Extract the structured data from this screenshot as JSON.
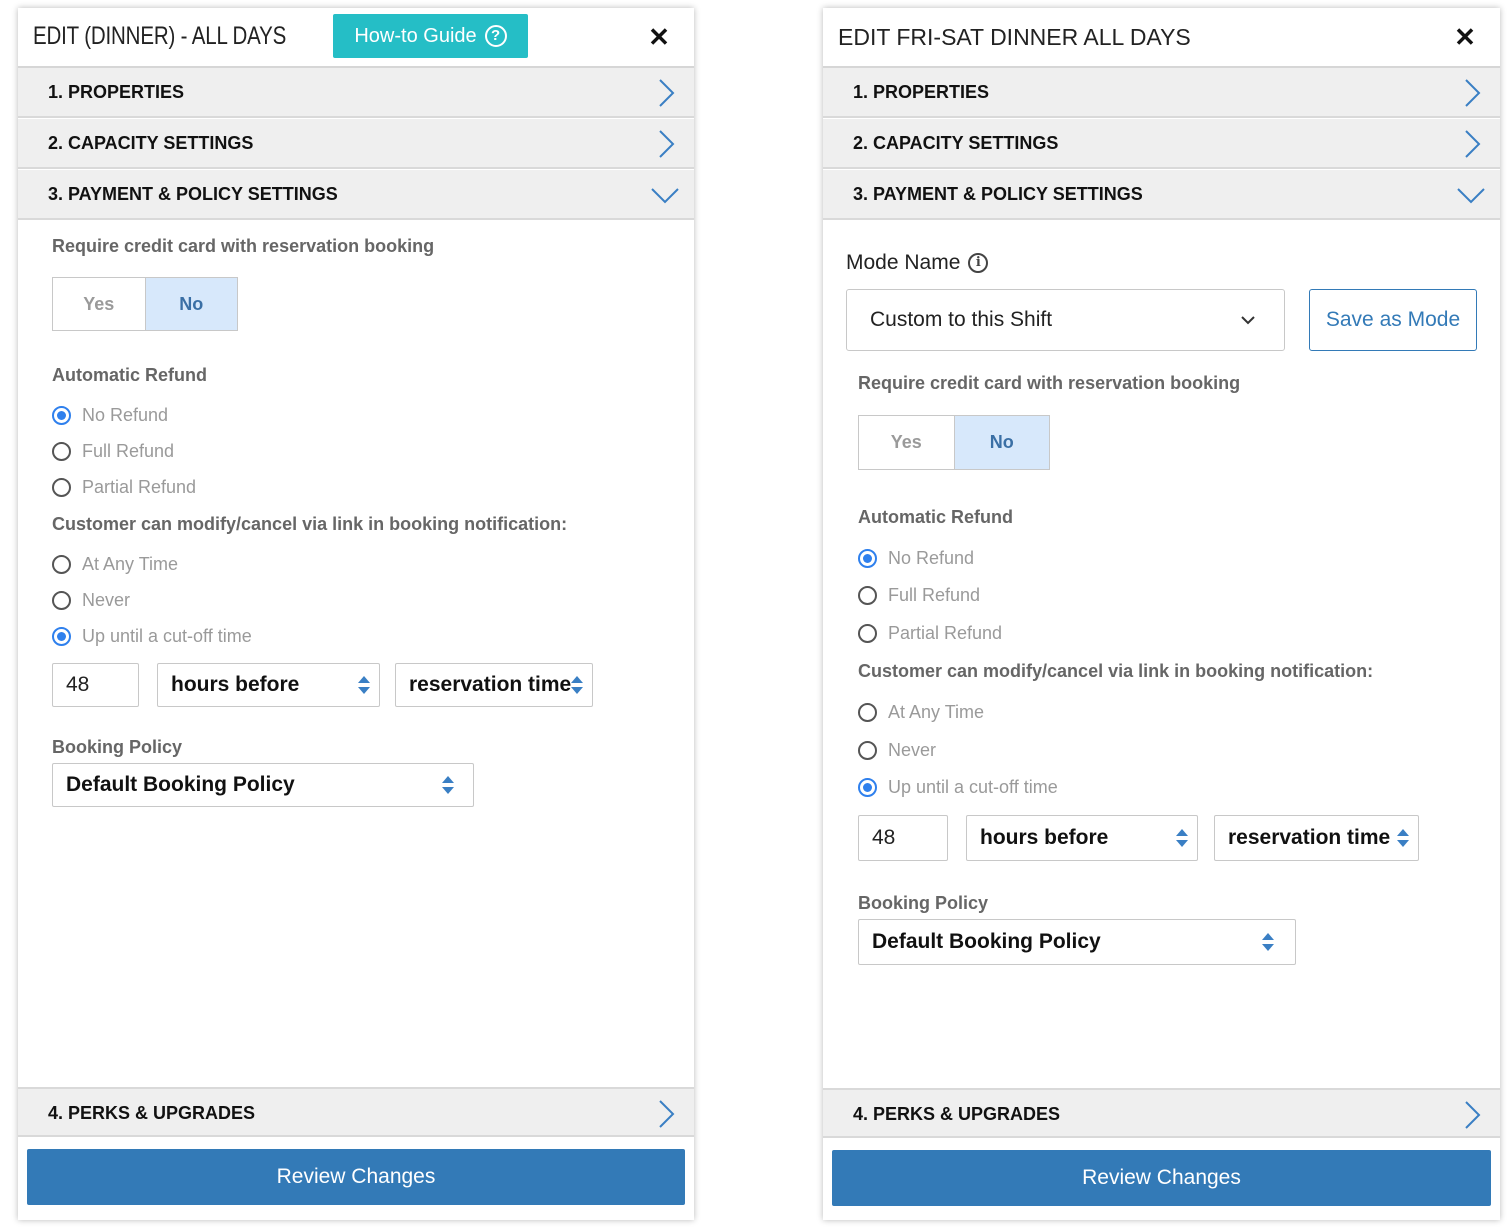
{
  "colors": {
    "accent": "#337ab7",
    "guide": "#25bec6",
    "radio_on": "#2f80ed",
    "selected_bg": "#d7e8fb"
  },
  "left": {
    "title": "EDIT (DINNER) - ALL DAYS",
    "guide_label": "How-to Guide",
    "close": "✕",
    "sections": [
      "1. PROPERTIES",
      "2. CAPACITY SETTINGS",
      "3. PAYMENT & POLICY SETTINGS",
      "4. PERKS & UPGRADES"
    ],
    "require_cc_label": "Require credit card with reservation booking",
    "yes": "Yes",
    "no": "No",
    "refund_label": "Automatic Refund",
    "refund_options": [
      "No Refund",
      "Full Refund",
      "Partial Refund"
    ],
    "refund_selected": "No Refund",
    "modify_label": "Customer can modify/cancel via link in booking notification:",
    "modify_options": [
      "At Any Time",
      "Never",
      "Up until a cut-off time"
    ],
    "modify_selected": "Up until a cut-off time",
    "cutoff_value": "48",
    "cutoff_unit": "hours before",
    "cutoff_ref": "reservation time",
    "policy_label": "Booking Policy",
    "policy_value": "Default Booking Policy",
    "review": "Review Changes"
  },
  "right": {
    "title": "EDIT FRI-SAT DINNER ALL DAYS",
    "close": "✕",
    "sections": [
      "1. PROPERTIES",
      "2. CAPACITY SETTINGS",
      "3. PAYMENT & POLICY SETTINGS",
      "4. PERKS & UPGRADES"
    ],
    "mode_name_label": "Mode Name",
    "mode_value": "Custom to this Shift",
    "save_mode": "Save as Mode",
    "require_cc_label": "Require credit card with reservation booking",
    "yes": "Yes",
    "no": "No",
    "refund_label": "Automatic Refund",
    "refund_options": [
      "No Refund",
      "Full Refund",
      "Partial Refund"
    ],
    "refund_selected": "No Refund",
    "modify_label": "Customer can modify/cancel via link in booking notification:",
    "modify_options": [
      "At Any Time",
      "Never",
      "Up until a cut-off time"
    ],
    "modify_selected": "Up until a cut-off time",
    "cutoff_value": "48",
    "cutoff_unit": "hours before",
    "cutoff_ref": "reservation time",
    "policy_label": "Booking Policy",
    "policy_value": "Default Booking Policy",
    "review": "Review Changes"
  }
}
